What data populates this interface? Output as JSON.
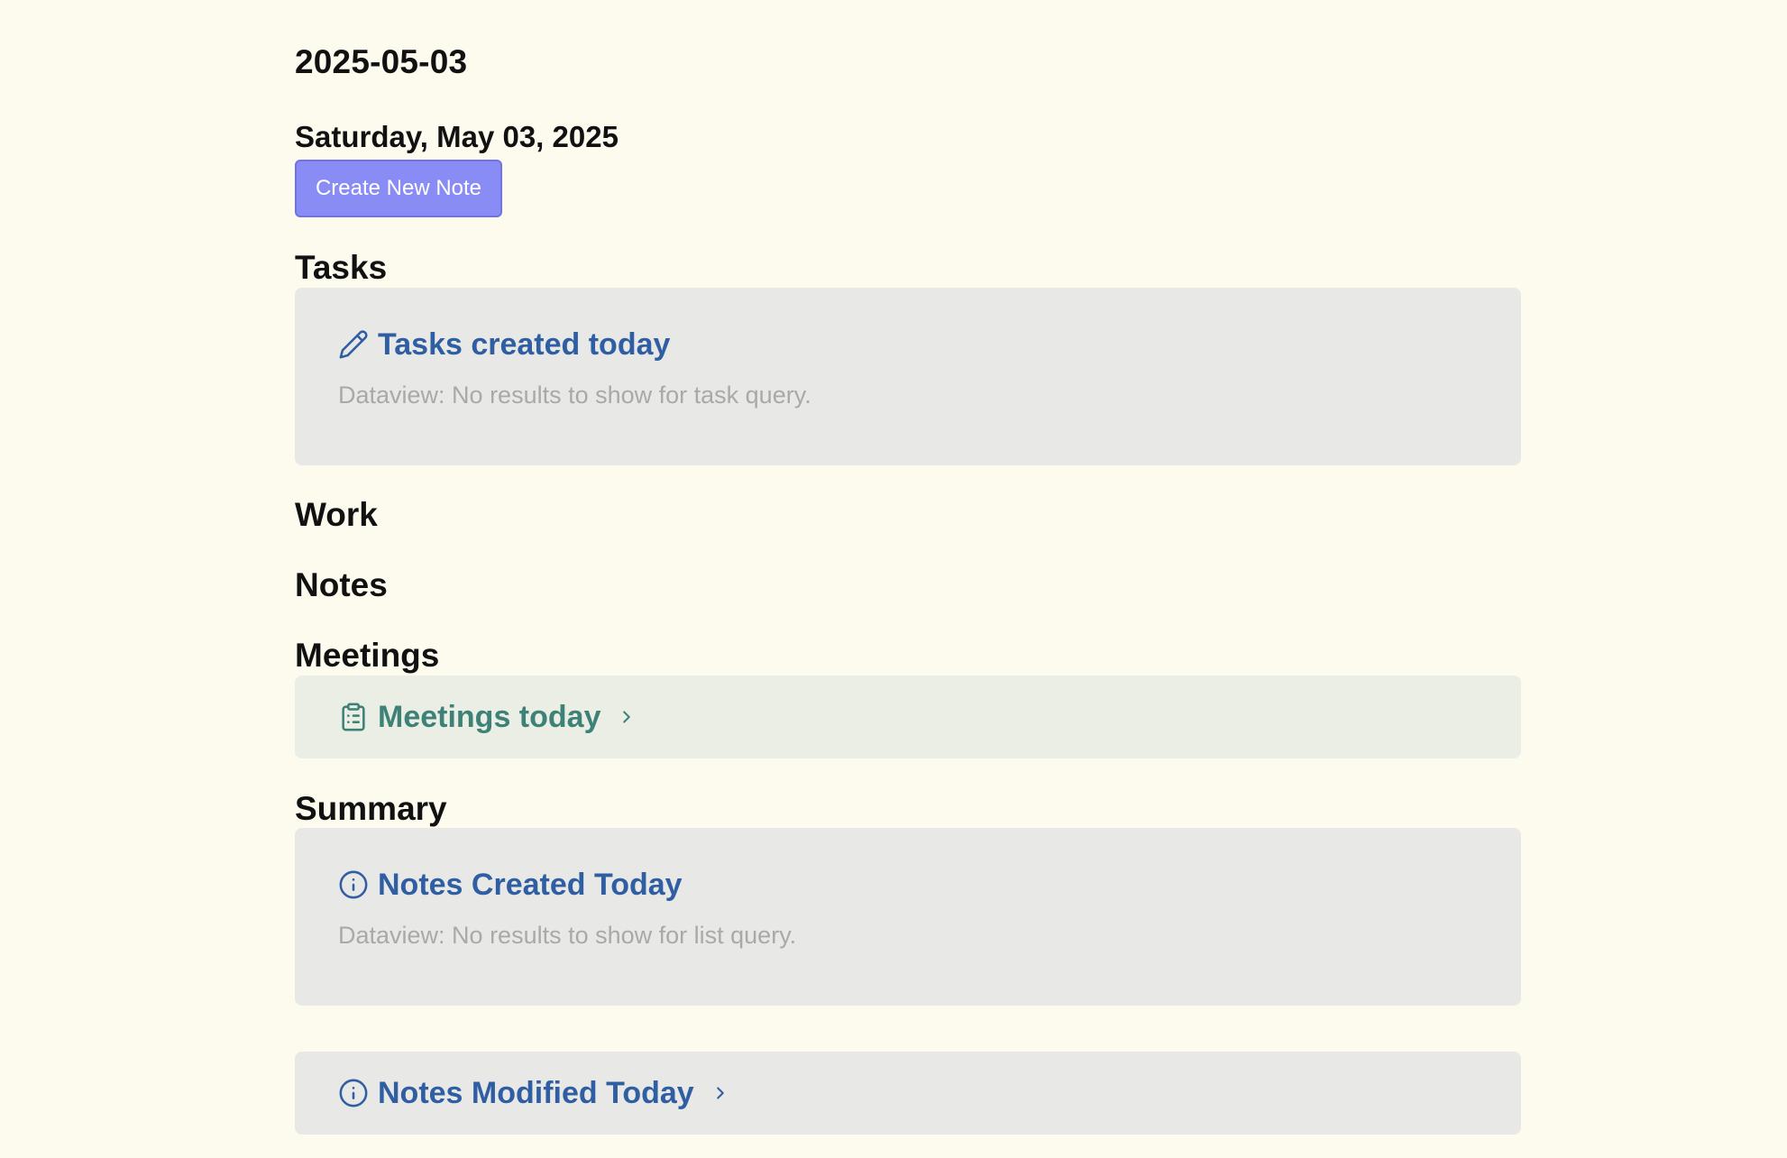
{
  "note": {
    "title": "2025-05-03",
    "date_heading": "Saturday, May 03, 2025",
    "create_button_label": "Create New Note"
  },
  "sections": {
    "tasks": "Tasks",
    "work": "Work",
    "notes": "Notes",
    "meetings": "Meetings",
    "summary": "Summary"
  },
  "callouts": {
    "tasks_created": {
      "title": "Tasks created today",
      "icon": "pencil-icon",
      "body": "Dataview: No results to show for task query."
    },
    "meetings_today": {
      "title": "Meetings today",
      "icon": "clipboard-list-icon",
      "collapsed": true
    },
    "notes_created": {
      "title": "Notes Created Today",
      "icon": "info-icon",
      "body": "Dataview: No results to show for list query."
    },
    "notes_modified": {
      "title": "Notes Modified Today",
      "icon": "info-icon",
      "collapsed": true
    }
  },
  "colors": {
    "background": "#fdfbee",
    "accent_button": "#8a8cf5",
    "callout_blue": "#2f5ea3",
    "callout_teal": "#3e8277",
    "callout_bg_gray": "#e8e9e6",
    "callout_bg_green": "#eaeee5",
    "muted_text": "#a9a9a7"
  }
}
